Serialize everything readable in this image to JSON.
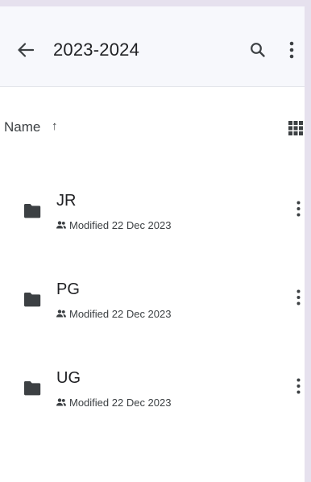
{
  "header": {
    "title": "2023-2024",
    "back_icon": "arrow-back-icon",
    "search_icon": "search-icon",
    "more_icon": "more-vert-icon"
  },
  "sort": {
    "label": "Name",
    "direction_glyph": "↑",
    "view_icon": "grid-view-icon"
  },
  "folders": [
    {
      "name": "JR",
      "modified": "Modified 22 Dec 2023",
      "shared": true
    },
    {
      "name": "PG",
      "modified": "Modified 22 Dec 2023",
      "shared": true
    },
    {
      "name": "UG",
      "modified": "Modified 22 Dec 2023",
      "shared": true
    }
  ],
  "colors": {
    "background": "#e6e1ee",
    "topbar": "#f7f8fc",
    "icon": "#3c4043"
  }
}
